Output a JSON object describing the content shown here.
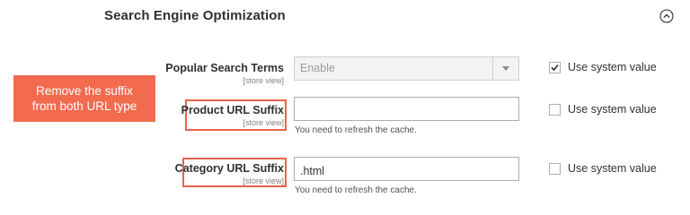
{
  "section": {
    "title": "Search Engine Optimization",
    "collapse_icon": "chevron-up-circle-icon"
  },
  "callout": {
    "line1": "Remove the suffix",
    "line2": "from both URL type",
    "color": "#f26b4f"
  },
  "fields": {
    "popular_search_terms": {
      "label": "Popular Search Terms",
      "scope": "[store view]",
      "value": "Enable",
      "disabled": true,
      "use_system_value_label": "Use system value",
      "use_system_value_checked": true
    },
    "product_url_suffix": {
      "label": "Product URL Suffix",
      "scope": "[store view]",
      "value": "",
      "note": "You need to refresh the cache.",
      "use_system_value_label": "Use system value",
      "use_system_value_checked": false
    },
    "category_url_suffix": {
      "label": "Category URL Suffix",
      "scope": "[store view]",
      "value": ".html",
      "note": "You need to refresh the cache.",
      "use_system_value_label": "Use system value",
      "use_system_value_checked": false
    }
  },
  "highlight_color": "#e8644a"
}
